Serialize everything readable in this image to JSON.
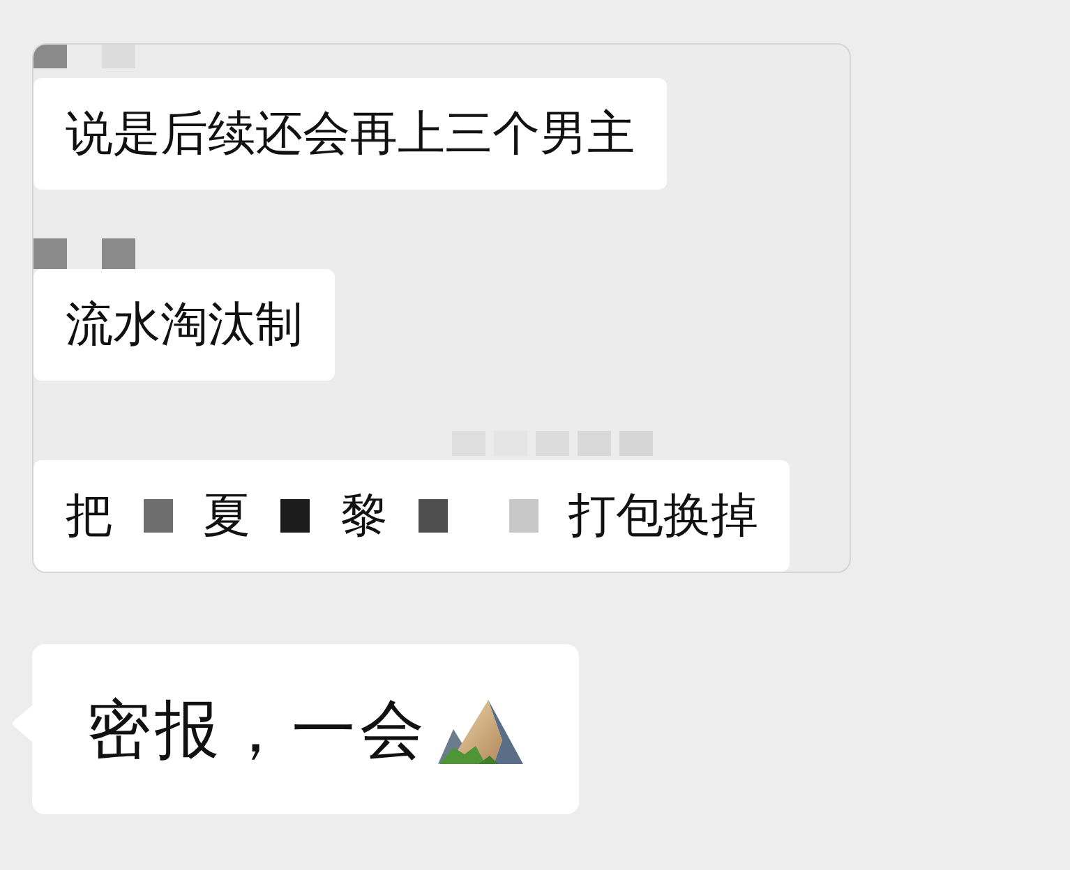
{
  "screenshot": {
    "messages": [
      {
        "segments": [
          {
            "kind": "text",
            "text": "说是后续还会再上三个男主"
          }
        ]
      },
      {
        "segments": [
          {
            "kind": "text",
            "text": "流水淘汰制"
          }
        ]
      },
      {
        "segments": [
          {
            "kind": "text",
            "text": "把"
          },
          {
            "kind": "redacted",
            "color": "#6e6e6e"
          },
          {
            "kind": "text",
            "text": "夏"
          },
          {
            "kind": "redacted",
            "color": "#1c1c1c"
          },
          {
            "kind": "text",
            "text": "黎"
          },
          {
            "kind": "redacted",
            "color": "#4f4f4f"
          },
          {
            "kind": "redacted",
            "color": "#c8c8c8"
          },
          {
            "kind": "text",
            "text": "打包换掉"
          }
        ]
      }
    ]
  },
  "chat": {
    "messages": [
      {
        "text": "密报，一会"
      }
    ]
  }
}
